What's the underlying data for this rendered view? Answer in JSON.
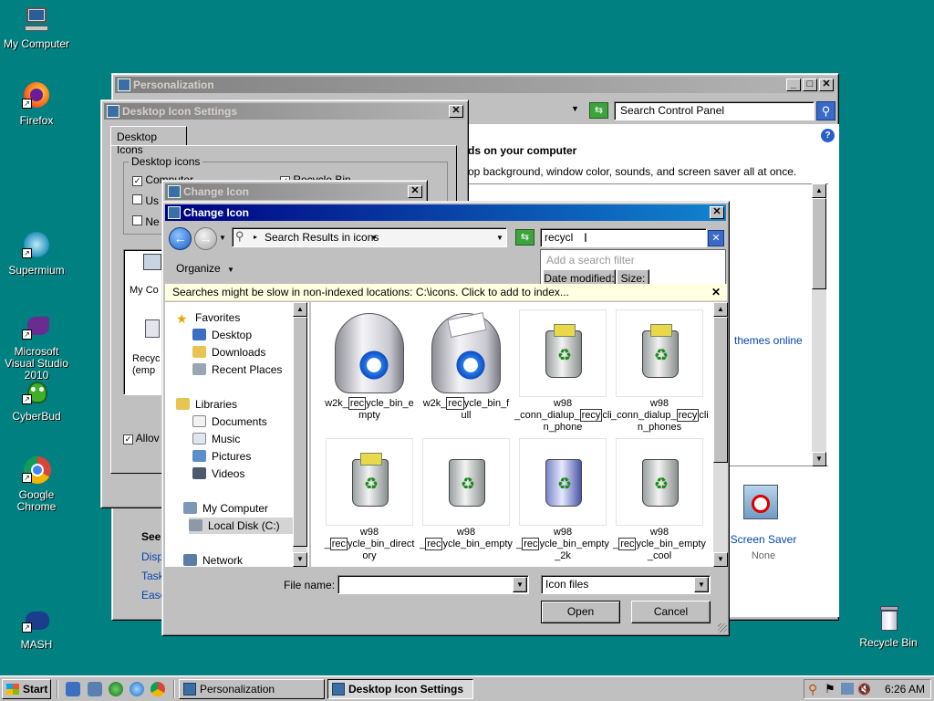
{
  "desktop": {
    "icons": [
      {
        "label": "My Computer"
      },
      {
        "label": "Firefox"
      },
      {
        "label": "Supermium"
      },
      {
        "label": "Microsoft Visual Studio 2010"
      },
      {
        "label": "CyberBud"
      },
      {
        "label": "Google Chrome"
      },
      {
        "label": "MASH"
      },
      {
        "label": "Recycle Bin"
      }
    ]
  },
  "personalization": {
    "title": "Personalization",
    "search_placeholder": "Search Control Panel",
    "heading": "ds on your computer",
    "subtext": "op background, window color, sounds, and screen saver all at once.",
    "themes_link": "themes online",
    "see_also": "See",
    "links": [
      "Displ",
      "Task",
      "Ease"
    ],
    "screen_saver_label": "Screen Saver",
    "screen_saver_value": "None"
  },
  "desktop_icon_settings": {
    "title": "Desktop Icon Settings",
    "tab": "Desktop Icons",
    "group": "Desktop icons",
    "checkboxes": [
      {
        "label": "Computer",
        "checked": true
      },
      {
        "label": "Recycle Bin",
        "checked": true
      },
      {
        "label": "Us",
        "checked": false
      },
      {
        "label": "Ne",
        "checked": false
      }
    ],
    "preview_items": [
      "My Co",
      "Recyc (emp"
    ],
    "allow_label": "Allov"
  },
  "change_icon_back": {
    "title": "Change Icon"
  },
  "change_icon": {
    "title": "Change Icon",
    "address": "Search Results in icons",
    "search_value": "recycl",
    "filter": {
      "placeholder": "Add a search filter",
      "buttons": [
        "Date modified:",
        "Size:"
      ]
    },
    "organize": "Organize",
    "infobar": "Searches might be slow in non-indexed locations: C:\\icons. Click to add to index...",
    "nav": {
      "favorites": "Favorites",
      "favorites_items": [
        "Desktop",
        "Downloads",
        "Recent Places"
      ],
      "libraries": "Libraries",
      "library_items": [
        "Documents",
        "Music",
        "Pictures",
        "Videos"
      ],
      "computer": "My Computer",
      "computer_items": [
        "Local Disk (C:)"
      ],
      "network": "Network"
    },
    "files": [
      {
        "pre": "w2k_",
        "hl": "rec",
        "post": "ycle_bin_e mpty"
      },
      {
        "pre": "w2k_",
        "hl": "rec",
        "post": "ycle_bin_f ull"
      },
      {
        "pre": "w98 _conn_dialup_",
        "hl": "recy",
        "post": "cli n_phone"
      },
      {
        "pre": "w98 _conn_dialup_",
        "hl": "recy",
        "post": "cli n_phones"
      },
      {
        "pre": "w98 _",
        "hl": "rec",
        "post": "ycle_bin_direct ory"
      },
      {
        "pre": "w98 _",
        "hl": "rec",
        "post": "ycle_bin_empty"
      },
      {
        "pre": "w98 _",
        "hl": "rec",
        "post": "ycle_bin_empty _2k"
      },
      {
        "pre": "w98 _",
        "hl": "rec",
        "post": "ycle_bin_empty _cool"
      }
    ],
    "file_name_label": "File name:",
    "file_name_value": "",
    "file_type": "Icon files",
    "open": "Open",
    "cancel": "Cancel"
  },
  "taskbar": {
    "start": "Start",
    "tasks": [
      "Personalization",
      "Desktop Icon Settings"
    ],
    "clock": "6:26 AM"
  }
}
